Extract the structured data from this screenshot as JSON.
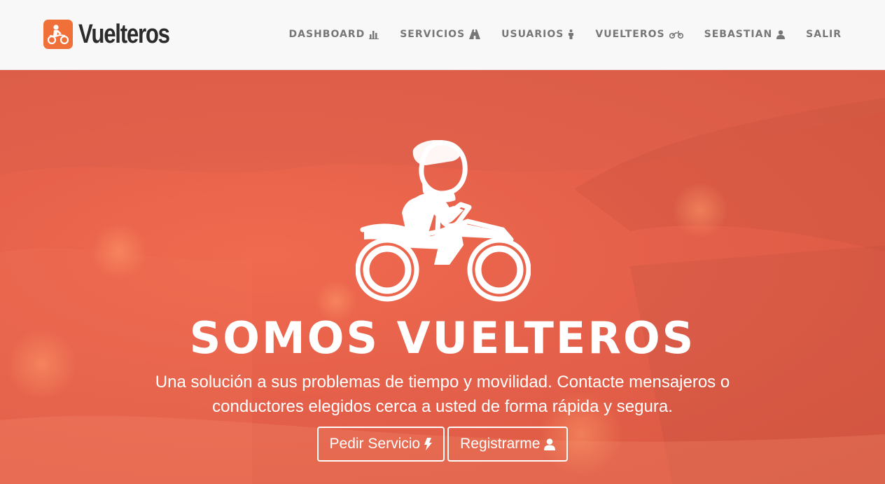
{
  "brand": {
    "name": "Vuelteros",
    "logo_color": "#f0703a",
    "logo_icon": "motorcycle-rider-icon"
  },
  "nav": {
    "items": [
      {
        "label": "DASHBOARD",
        "icon": "bar-chart-icon"
      },
      {
        "label": "SERVICIOS",
        "icon": "road-icon"
      },
      {
        "label": "USUARIOS",
        "icon": "male-icon"
      },
      {
        "label": "VUELTEROS",
        "icon": "motorcycle-icon"
      },
      {
        "label": "SEBASTIAN",
        "icon": "user-icon"
      },
      {
        "label": "SALIR",
        "icon": ""
      }
    ]
  },
  "hero": {
    "icon": "motorcycle-rider-icon",
    "title": "SOMOS VUELTEROS",
    "subtitle": "Una solución a sus problemas de tiempo y movilidad. Contacte mensajeros o conductores elegidos cerca a usted de forma rápida y segura.",
    "buttons": [
      {
        "label": "Pedir Servicio",
        "icon": "bolt-icon"
      },
      {
        "label": "Registrarme",
        "icon": "user-icon"
      }
    ]
  },
  "colors": {
    "hero_overlay": "#e2614a",
    "navbar_bg": "#f8f8f8",
    "nav_text": "#777777",
    "text_light": "#ffffff"
  }
}
